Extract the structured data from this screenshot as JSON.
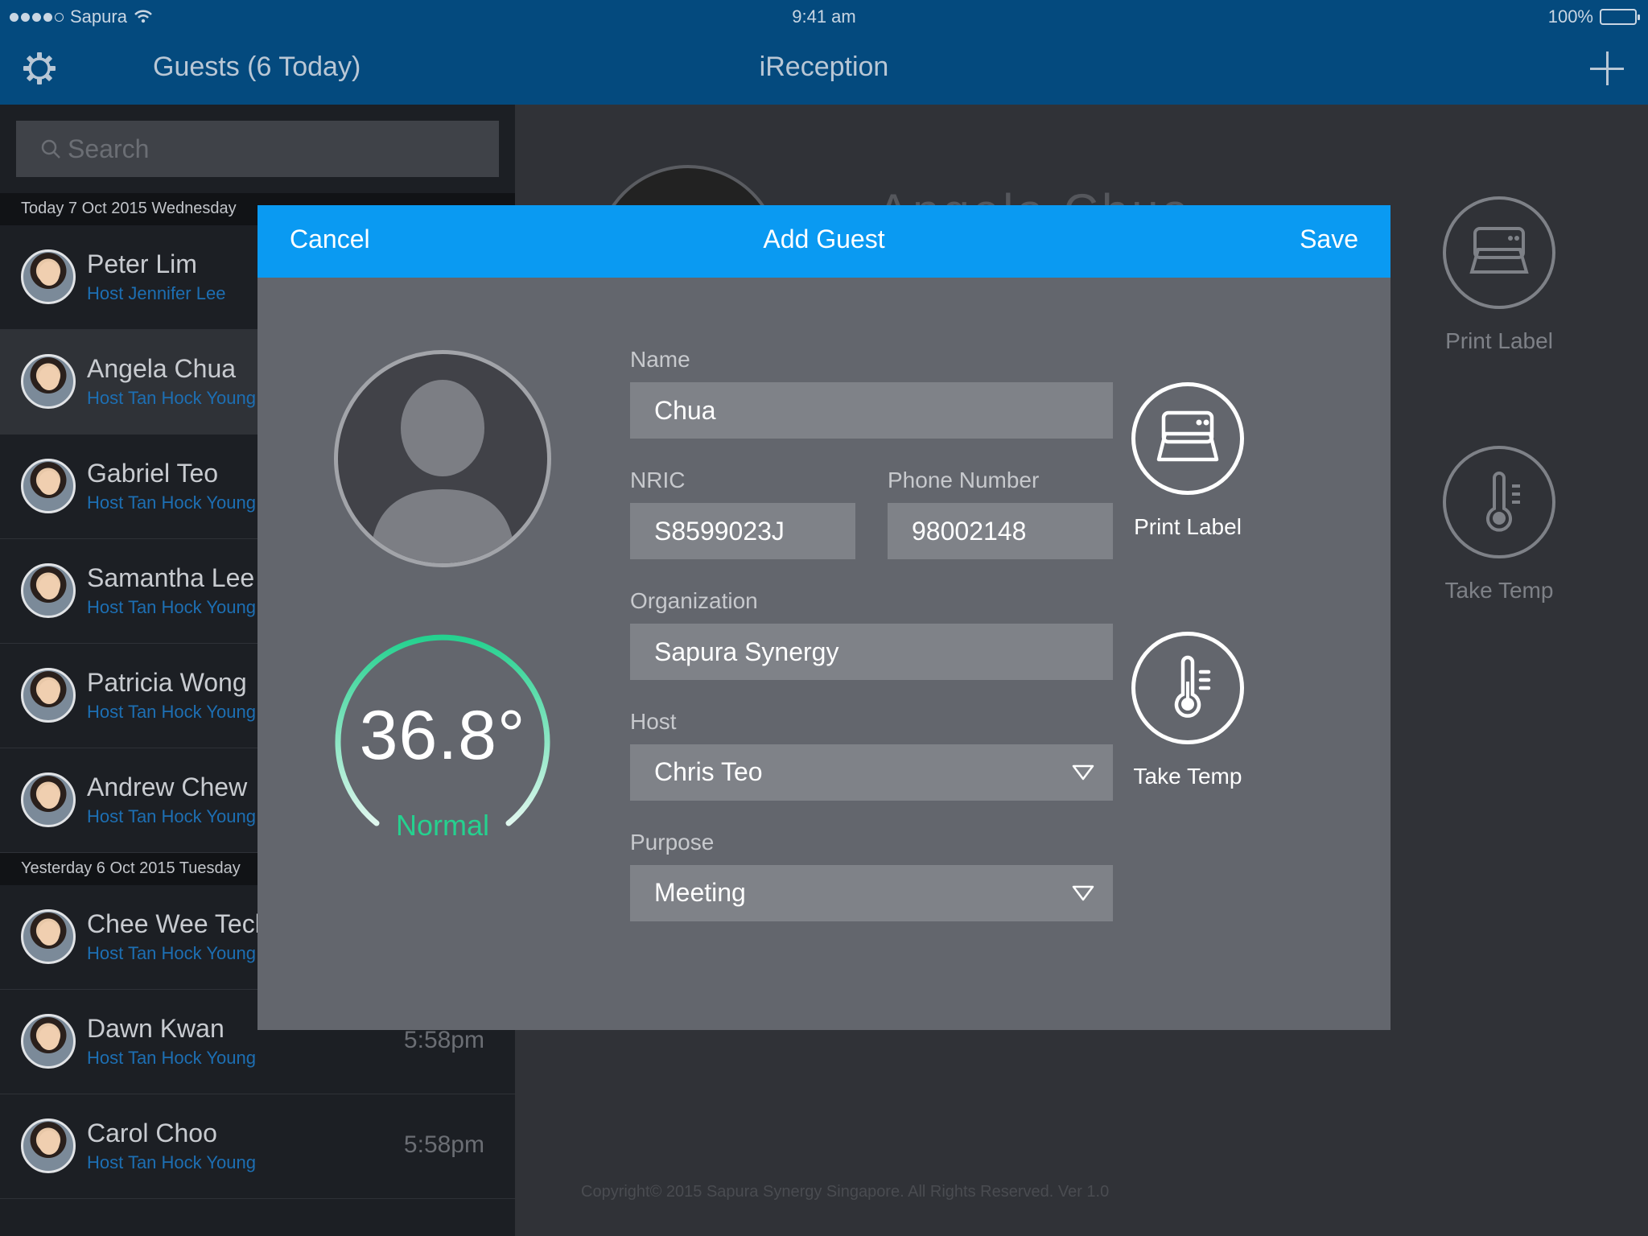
{
  "status_bar": {
    "carrier": "Sapura",
    "time": "9:41 am",
    "battery": "100%"
  },
  "nav": {
    "guests_title": "Guests (6 Today)",
    "app_title": "iReception",
    "settings_icon": "gear-icon",
    "add_icon": "plus-icon"
  },
  "search": {
    "placeholder": "Search"
  },
  "sections": {
    "today": "Today 7 Oct 2015 Wednesday",
    "yesterday": "Yesterday 6 Oct 2015 Tuesday"
  },
  "guests_today": [
    {
      "name": "Peter Lim",
      "host": "Host Jennifer Lee",
      "time": ""
    },
    {
      "name": "Angela Chua",
      "host": "Host Tan Hock Young",
      "time": ""
    },
    {
      "name": "Gabriel Teo",
      "host": "Host Tan Hock Young",
      "time": ""
    },
    {
      "name": "Samantha Lee",
      "host": "Host Tan Hock Young",
      "time": ""
    },
    {
      "name": "Patricia Wong",
      "host": "Host Tan Hock Young",
      "time": ""
    },
    {
      "name": "Andrew Chew",
      "host": "Host Tan Hock Young",
      "time": ""
    }
  ],
  "guests_yesterday": [
    {
      "name": "Chee Wee Teck",
      "host": "Host Tan Hock Young",
      "time": ""
    },
    {
      "name": "Dawn Kwan",
      "host": "Host Tan Hock Young",
      "time": "5:58pm"
    },
    {
      "name": "Carol Choo",
      "host": "Host Tan Hock Young",
      "time": "5:58pm"
    }
  ],
  "detail": {
    "name": "Angela Chua",
    "print_label": "Print Label",
    "take_temp": "Take Temp",
    "copyright": "Copyright© 2015 Sapura Synergy Singapore. All Rights Reserved. Ver 1.0"
  },
  "modal": {
    "title": "Add Guest",
    "cancel": "Cancel",
    "save": "Save",
    "temperature": {
      "value": "36.8°",
      "status": "Normal",
      "status_color": "#25d18f"
    },
    "fields": {
      "name_label": "Name",
      "name_value": "Chua",
      "nric_label": "NRIC",
      "nric_value": "S8599023J",
      "phone_label": "Phone Number",
      "phone_value": "98002148",
      "org_label": "Organization",
      "org_value": "Sapura Synergy",
      "host_label": "Host",
      "host_value": "Chris Teo",
      "purpose_label": "Purpose",
      "purpose_value": "Meeting"
    },
    "actions": {
      "print_label": "Print Label",
      "take_temp": "Take Temp"
    }
  },
  "colors": {
    "nav_bar": "#044a7e",
    "modal_header": "#0a9af2",
    "host_link": "#1d6fb3",
    "gauge_gradient_start": "#25d18f"
  }
}
